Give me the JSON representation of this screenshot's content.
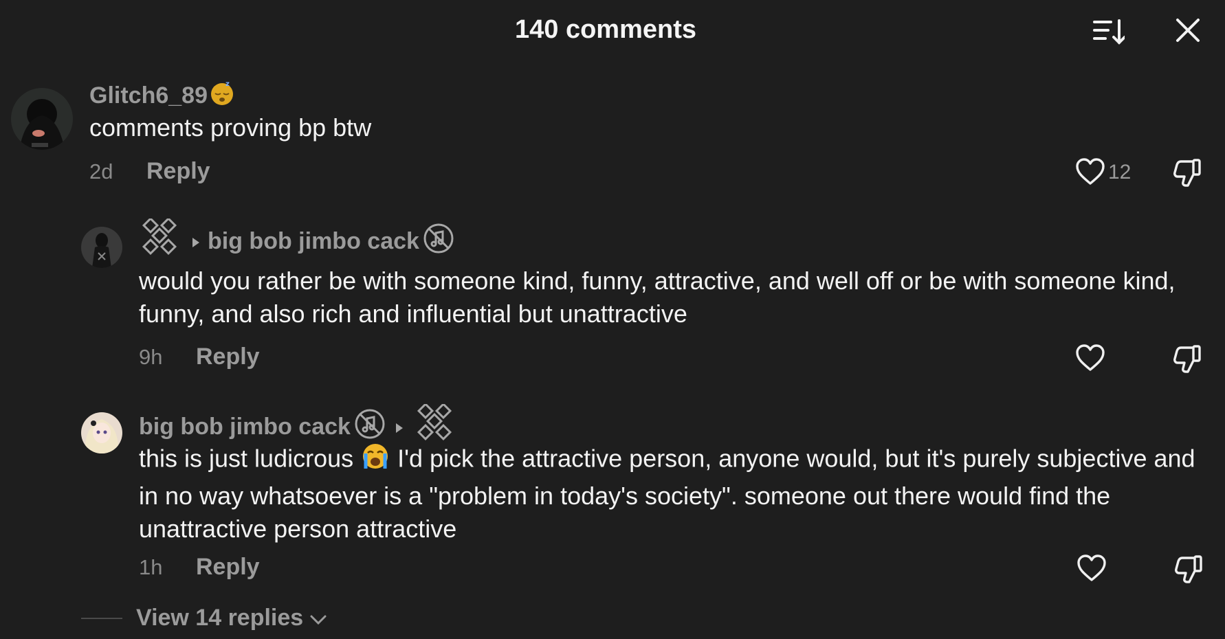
{
  "header": {
    "title": "140 comments",
    "sort_icon": "sort-descending-icon",
    "close_icon": "close-icon"
  },
  "comments": [
    {
      "username": "Glitch6_89",
      "username_emoji": "sleeping-face-emoji",
      "text": "comments proving bp btw",
      "time": "2d",
      "reply_label": "Reply",
      "like_count": "12"
    },
    {
      "from_user": "",
      "to_user": "big bob jimbo cack",
      "text": "would you rather be with someone kind, funny, attractive, and well off or be with someone kind, funny, and also rich and influential but unattractive",
      "time": "9h",
      "reply_label": "Reply"
    },
    {
      "from_user": "big bob jimbo cack",
      "to_user": "",
      "text_before_emoji": "this is just ludicrous ",
      "text_after_emoji": " I'd pick the attractive person, anyone would, but it's purely subjective and in no way whatsoever is a \"problem in today's society\". someone out there would find the unattractive person attractive",
      "emoji": "loudly-crying-face-emoji",
      "time": "1h",
      "reply_label": "Reply"
    }
  ],
  "view_replies": {
    "label": "View 14 replies"
  },
  "colors": {
    "background": "#1e1e1e",
    "text": "#f3f3f3",
    "muted": "#9b9b9b"
  }
}
